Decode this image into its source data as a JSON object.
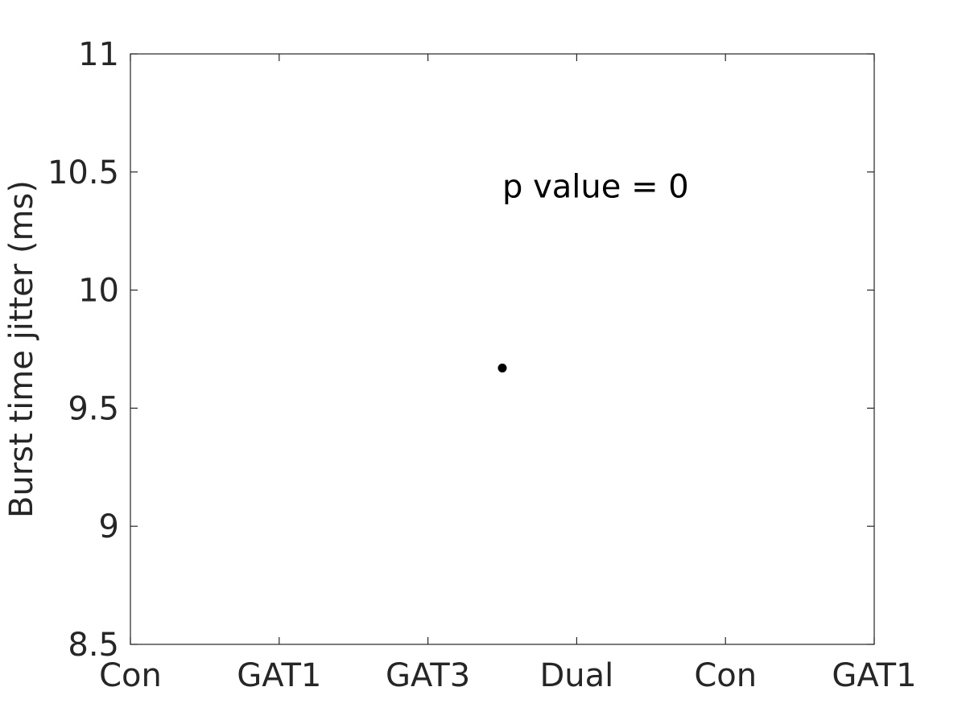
{
  "chart_data": {
    "type": "scatter",
    "title": "",
    "xlabel": "",
    "ylabel": "Burst time jitter (ms)",
    "categories": [
      "Con",
      "GAT1",
      "GAT3",
      "Dual",
      "Con",
      "GAT1"
    ],
    "x_ticks": [
      1,
      2,
      3,
      4,
      5,
      6
    ],
    "xlim": [
      1,
      6
    ],
    "ylim": [
      8.5,
      11
    ],
    "y_ticks": [
      8.5,
      9,
      9.5,
      10,
      10.5,
      11
    ],
    "y_tick_labels": [
      "8.5",
      "9",
      "9.5",
      "10",
      "10.5",
      "11"
    ],
    "grid": false,
    "series": [
      {
        "name": "data",
        "color": "#000000",
        "points": [
          {
            "x": 3.5,
            "y": 9.67
          }
        ]
      }
    ],
    "annotations": [
      {
        "text": "p value = 0",
        "x": 3.5,
        "y": 10.44
      }
    ]
  }
}
